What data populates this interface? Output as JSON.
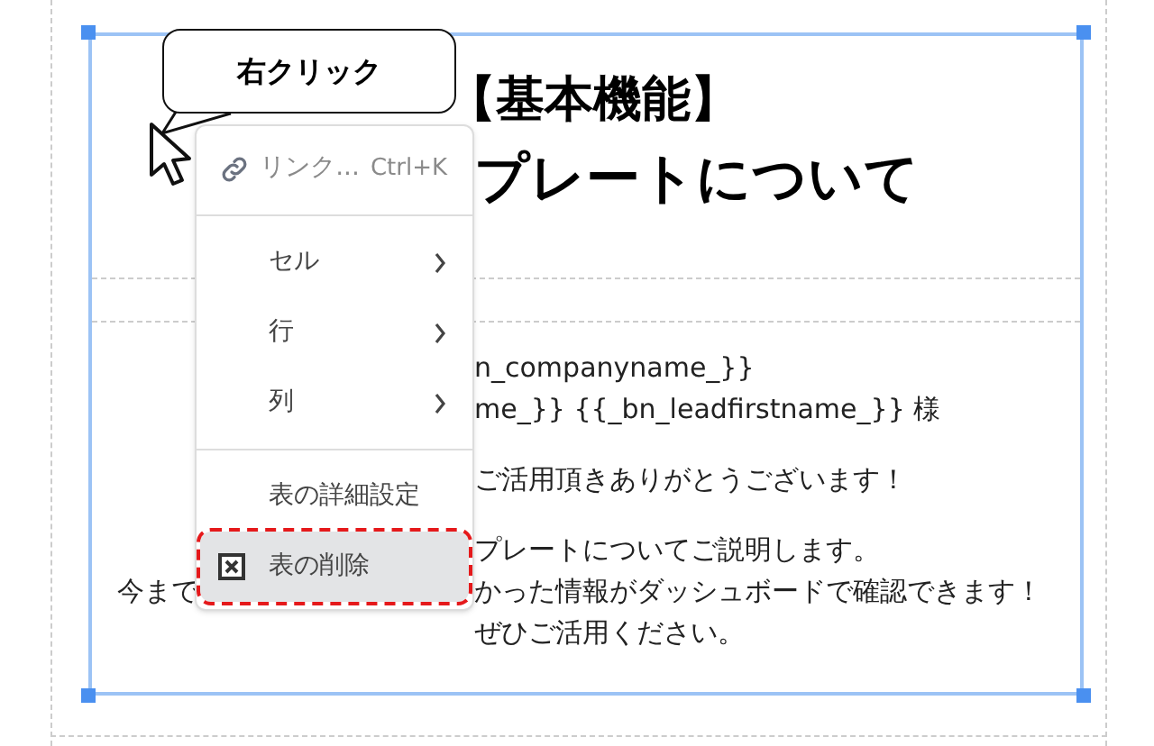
{
  "callout": {
    "label": "右クリック"
  },
  "document": {
    "title_lines": [
      "【基本機能】",
      "プレートについて"
    ],
    "paragraphs": [
      [
        {
          "text": "n_companyname_}}"
        },
        {
          "text": "me_}} {{_bn_leadfirstname_}} 様"
        }
      ],
      [
        {
          "text": "ご活用頂きありがとうございます！"
        }
      ],
      [
        {
          "text": "プレートについてご説明します。"
        },
        {
          "lead": "今まで",
          "text": "かった情報がダッシュボードで確認できます！"
        },
        {
          "text": "ぜひご活用ください。"
        }
      ]
    ]
  },
  "context_menu": {
    "groups": [
      [
        {
          "kind": "link",
          "label": "リンク...",
          "shortcut": "Ctrl+K",
          "disabled": true,
          "selected": false
        }
      ],
      [
        {
          "kind": "submenu",
          "label": "セル",
          "disabled": false,
          "selected": false
        },
        {
          "kind": "submenu",
          "label": "行",
          "disabled": false,
          "selected": false
        },
        {
          "kind": "submenu",
          "label": "列",
          "disabled": false,
          "selected": false
        }
      ],
      [
        {
          "kind": "plain",
          "label": "表の詳細設定",
          "disabled": false,
          "selected": false
        },
        {
          "kind": "delete",
          "label": "表の削除",
          "disabled": false,
          "selected": true
        }
      ]
    ]
  }
}
